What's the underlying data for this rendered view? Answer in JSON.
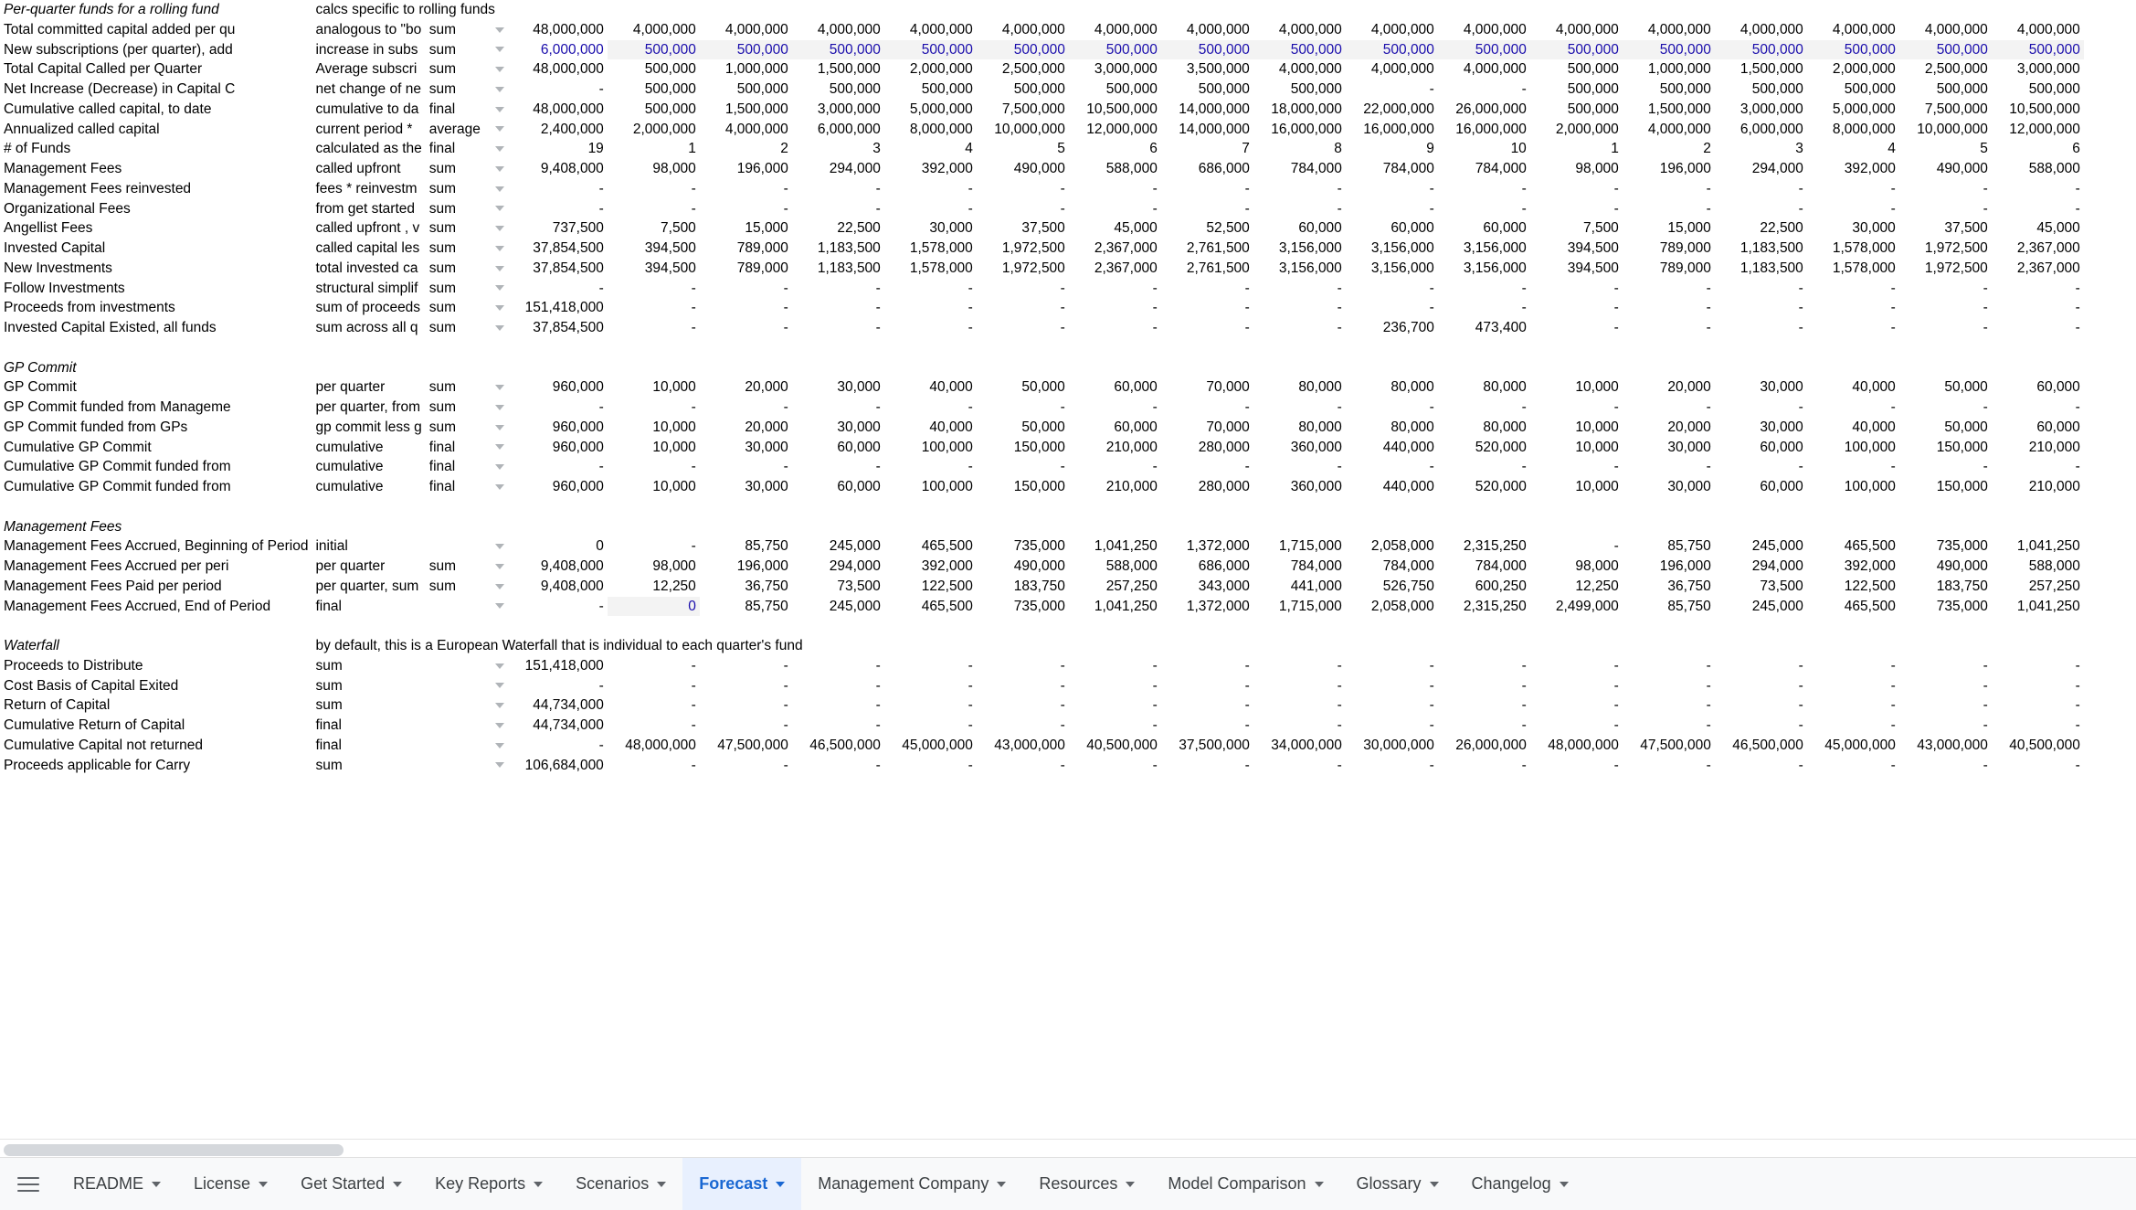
{
  "sheet": {
    "columns": {
      "label_header": "",
      "description_header": "",
      "agg_header": "",
      "total_header": "",
      "quarter_count": 16
    },
    "sections": [
      {
        "title": "Per-quarter funds for a rolling fund",
        "note": "calcs specific to rolling funds",
        "rows": [
          {
            "label": "Total committed capital added per qu",
            "desc": "analogous to \"bo",
            "agg": "sum",
            "total": "48,000,000",
            "values": [
              "4,000,000",
              "4,000,000",
              "4,000,000",
              "4,000,000",
              "4,000,000",
              "4,000,000",
              "4,000,000",
              "4,000,000",
              "4,000,000",
              "4,000,000"
            ]
          },
          {
            "label": "New subscriptions (per quarter), add",
            "desc": "increase in subs",
            "agg": "sum",
            "total": "6,000,000",
            "input": true,
            "values": [
              "500,000",
              "500,000",
              "500,000",
              "500,000",
              "500,000",
              "500,000",
              "500,000",
              "500,000",
              "500,000",
              "500,000"
            ]
          },
          {
            "label": "Total Capital Called per Quarter",
            "desc": "Average subscri",
            "agg": "sum",
            "total": "48,000,000",
            "values": [
              "500,000",
              "1,000,000",
              "1,500,000",
              "2,000,000",
              "2,500,000",
              "3,000,000",
              "3,500,000",
              "4,000,000",
              "4,000,000",
              "4,000,000"
            ]
          },
          {
            "label": "Net Increase (Decrease) in Capital C",
            "desc": "net change of ne",
            "agg": "sum",
            "total": "-",
            "values": [
              "500,000",
              "500,000",
              "500,000",
              "500,000",
              "500,000",
              "500,000",
              "500,000",
              "500,000",
              "-",
              "-"
            ]
          },
          {
            "label": "Cumulative called capital, to date",
            "desc": "cumulative to da",
            "agg": "final",
            "total": "48,000,000",
            "values": [
              "500,000",
              "1,500,000",
              "3,000,000",
              "5,000,000",
              "7,500,000",
              "10,500,000",
              "14,000,000",
              "18,000,000",
              "22,000,000",
              "26,000,000"
            ]
          },
          {
            "label": "Annualized called capital",
            "desc": "current period * ",
            "agg": "average",
            "total": "2,400,000",
            "values": [
              "2,000,000",
              "4,000,000",
              "6,000,000",
              "8,000,000",
              "10,000,000",
              "12,000,000",
              "14,000,000",
              "16,000,000",
              "16,000,000",
              "16,000,000"
            ]
          },
          {
            "label": "# of Funds",
            "desc": "calculated as the",
            "agg": "final",
            "total": "19",
            "values": [
              "1",
              "2",
              "3",
              "4",
              "5",
              "6",
              "7",
              "8",
              "9",
              "10"
            ]
          },
          {
            "label": "Management Fees",
            "desc": "called upfront",
            "agg": "sum",
            "total": "9,408,000",
            "values": [
              "98,000",
              "196,000",
              "294,000",
              "392,000",
              "490,000",
              "588,000",
              "686,000",
              "784,000",
              "784,000",
              "784,000"
            ]
          },
          {
            "label": "Management Fees reinvested",
            "desc": "fees * reinvestm",
            "agg": "sum",
            "total": "-",
            "values": [
              "-",
              "-",
              "-",
              "-",
              "-",
              "-",
              "-",
              "-",
              "-",
              "-"
            ]
          },
          {
            "label": "Organizational Fees",
            "desc": "from get started",
            "agg": "sum",
            "total": "-",
            "values": [
              "-",
              "-",
              "-",
              "-",
              "-",
              "-",
              "-",
              "-",
              "-",
              "-"
            ]
          },
          {
            "label": "Angellist Fees",
            "desc": "called upfront , v",
            "agg": "sum",
            "total": "737,500",
            "values": [
              "7,500",
              "15,000",
              "22,500",
              "30,000",
              "37,500",
              "45,000",
              "52,500",
              "60,000",
              "60,000",
              "60,000"
            ]
          },
          {
            "label": "Invested Capital",
            "desc": "called capital les",
            "agg": "sum",
            "total": "37,854,500",
            "values": [
              "394,500",
              "789,000",
              "1,183,500",
              "1,578,000",
              "1,972,500",
              "2,367,000",
              "2,761,500",
              "3,156,000",
              "3,156,000",
              "3,156,000"
            ]
          },
          {
            "label": "New Investments",
            "desc": "total invested ca",
            "agg": "sum",
            "total": "37,854,500",
            "values": [
              "394,500",
              "789,000",
              "1,183,500",
              "1,578,000",
              "1,972,500",
              "2,367,000",
              "2,761,500",
              "3,156,000",
              "3,156,000",
              "3,156,000"
            ]
          },
          {
            "label": "Follow Investments",
            "desc": "structural simplif",
            "agg": "sum",
            "total": "-",
            "values": [
              "-",
              "-",
              "-",
              "-",
              "-",
              "-",
              "-",
              "-",
              "-",
              "-"
            ]
          },
          {
            "label": "Proceeds from investments",
            "desc": "sum of proceeds",
            "agg": "sum",
            "total": "151,418,000",
            "values": [
              "-",
              "-",
              "-",
              "-",
              "-",
              "-",
              "-",
              "-",
              "-",
              "-"
            ]
          },
          {
            "label": "Invested Capital Existed, all funds",
            "desc": "sum across all q",
            "agg": "sum",
            "total": "37,854,500",
            "values": [
              "-",
              "-",
              "-",
              "-",
              "-",
              "-",
              "-",
              "-",
              "236,700",
              "473,400"
            ]
          }
        ]
      },
      {
        "title": "GP Commit",
        "note": "",
        "rows": [
          {
            "label": "GP Commit",
            "desc": "per quarter",
            "agg": "sum",
            "total": "960,000",
            "values": [
              "10,000",
              "20,000",
              "30,000",
              "40,000",
              "50,000",
              "60,000",
              "70,000",
              "80,000",
              "80,000",
              "80,000"
            ]
          },
          {
            "label": "GP Commit funded from Manageme",
            "desc": "per quarter, from",
            "agg": "sum",
            "total": "-",
            "values": [
              "-",
              "-",
              "-",
              "-",
              "-",
              "-",
              "-",
              "-",
              "-",
              "-"
            ]
          },
          {
            "label": "GP Commit funded from GPs",
            "desc": "gp commit less g",
            "agg": "sum",
            "total": "960,000",
            "values": [
              "10,000",
              "20,000",
              "30,000",
              "40,000",
              "50,000",
              "60,000",
              "70,000",
              "80,000",
              "80,000",
              "80,000"
            ]
          },
          {
            "label": "Cumulative GP Commit",
            "desc": "cumulative",
            "agg": "final",
            "total": "960,000",
            "values": [
              "10,000",
              "30,000",
              "60,000",
              "100,000",
              "150,000",
              "210,000",
              "280,000",
              "360,000",
              "440,000",
              "520,000"
            ]
          },
          {
            "label": "Cumulative GP Commit funded from",
            "desc": "cumulative",
            "agg": "final",
            "total": "-",
            "values": [
              "-",
              "-",
              "-",
              "-",
              "-",
              "-",
              "-",
              "-",
              "-",
              "-"
            ]
          },
          {
            "label": "Cumulative GP Commit funded from",
            "desc": "cumulative",
            "agg": "final",
            "total": "960,000",
            "values": [
              "10,000",
              "30,000",
              "60,000",
              "100,000",
              "150,000",
              "210,000",
              "280,000",
              "360,000",
              "440,000",
              "520,000"
            ]
          }
        ]
      },
      {
        "title": "Management Fees",
        "note": "",
        "rows": [
          {
            "label": "Management Fees Accrued, Beginning of Period",
            "desc": "initial",
            "agg": "",
            "total": "0",
            "values": [
              "-",
              "85,750",
              "245,000",
              "465,500",
              "735,000",
              "1,041,250",
              "1,372,000",
              "1,715,000",
              "2,058,000",
              "2,315,250"
            ]
          },
          {
            "label": "Management Fees Accrued per peri",
            "desc": "per quarter",
            "agg": "sum",
            "total": "9,408,000",
            "values": [
              "98,000",
              "196,000",
              "294,000",
              "392,000",
              "490,000",
              "588,000",
              "686,000",
              "784,000",
              "784,000",
              "784,000"
            ]
          },
          {
            "label": "Management Fees Paid per period",
            "desc": "per quarter, sum",
            "agg": "sum",
            "total": "9,408,000",
            "values": [
              "12,250",
              "36,750",
              "73,500",
              "122,500",
              "183,750",
              "257,250",
              "343,000",
              "441,000",
              "526,750",
              "600,250"
            ]
          },
          {
            "label": "Management Fees Accrued, End of Period",
            "desc": "final",
            "agg": "",
            "total": "-",
            "extra": "0",
            "values": [
              "85,750",
              "245,000",
              "465,500",
              "735,000",
              "1,041,250",
              "1,372,000",
              "1,715,000",
              "2,058,000",
              "2,315,250",
              "2,499,000"
            ]
          }
        ]
      },
      {
        "title": "Waterfall",
        "note": "by default, this is a European Waterfall that is individual to each quarter's fund",
        "rows": [
          {
            "label": "Proceeds to Distribute",
            "desc": "sum",
            "agg": "",
            "total": "151,418,000",
            "values": [
              "-",
              "-",
              "-",
              "-",
              "-",
              "-",
              "-",
              "-",
              "-",
              "-"
            ]
          },
          {
            "label": "Cost Basis of Capital Exited",
            "desc": "sum",
            "agg": "",
            "total": "-",
            "values": [
              "-",
              "-",
              "-",
              "-",
              "-",
              "-",
              "-",
              "-",
              "-",
              "-"
            ]
          },
          {
            "label": "Return of Capital",
            "desc": "sum",
            "agg": "",
            "total": "44,734,000",
            "values": [
              "-",
              "-",
              "-",
              "-",
              "-",
              "-",
              "-",
              "-",
              "-",
              "-"
            ]
          },
          {
            "label": "Cumulative Return of Capital",
            "desc": "final",
            "agg": "",
            "total": "44,734,000",
            "values": [
              "-",
              "-",
              "-",
              "-",
              "-",
              "-",
              "-",
              "-",
              "-",
              "-"
            ]
          },
          {
            "label": "Cumulative Capital not returned",
            "desc": "final",
            "agg": "",
            "total": "-",
            "values": [
              "48,000,000",
              "47,500,000",
              "46,500,000",
              "45,000,000",
              "43,000,000",
              "40,500,000",
              "37,500,000",
              "34,000,000",
              "30,000,000",
              "26,000,000"
            ]
          },
          {
            "label": "Proceeds applicable for Carry",
            "desc": "sum",
            "agg": "",
            "total": "106,684,000",
            "values": [
              "-",
              "-",
              "-",
              "-",
              "-",
              "-",
              "-",
              "-",
              "-",
              "-"
            ]
          }
        ]
      }
    ]
  },
  "tabbar": {
    "menu_icon": "hamburger-icon",
    "tabs": [
      {
        "label": "README",
        "active": false
      },
      {
        "label": "License",
        "active": false
      },
      {
        "label": "Get Started",
        "active": false
      },
      {
        "label": "Key Reports",
        "active": false
      },
      {
        "label": "Scenarios",
        "active": false
      },
      {
        "label": "Forecast",
        "active": true
      },
      {
        "label": "Management Company",
        "active": false
      },
      {
        "label": "Resources",
        "active": false
      },
      {
        "label": "Model Comparison",
        "active": false
      },
      {
        "label": "Glossary",
        "active": false
      },
      {
        "label": "Changelog",
        "active": false
      }
    ]
  },
  "colors": {
    "active_tab_text": "#1967d2",
    "active_tab_bg": "#e8f0fe",
    "input_value_text": "#1a0dab",
    "input_row_bg": "#f3f3f3",
    "tabbar_bg": "#f8f9fa",
    "scrollbar_thumb": "#d5d8dc"
  },
  "scrollbar": {
    "name": "horizontal-scrollbar"
  }
}
